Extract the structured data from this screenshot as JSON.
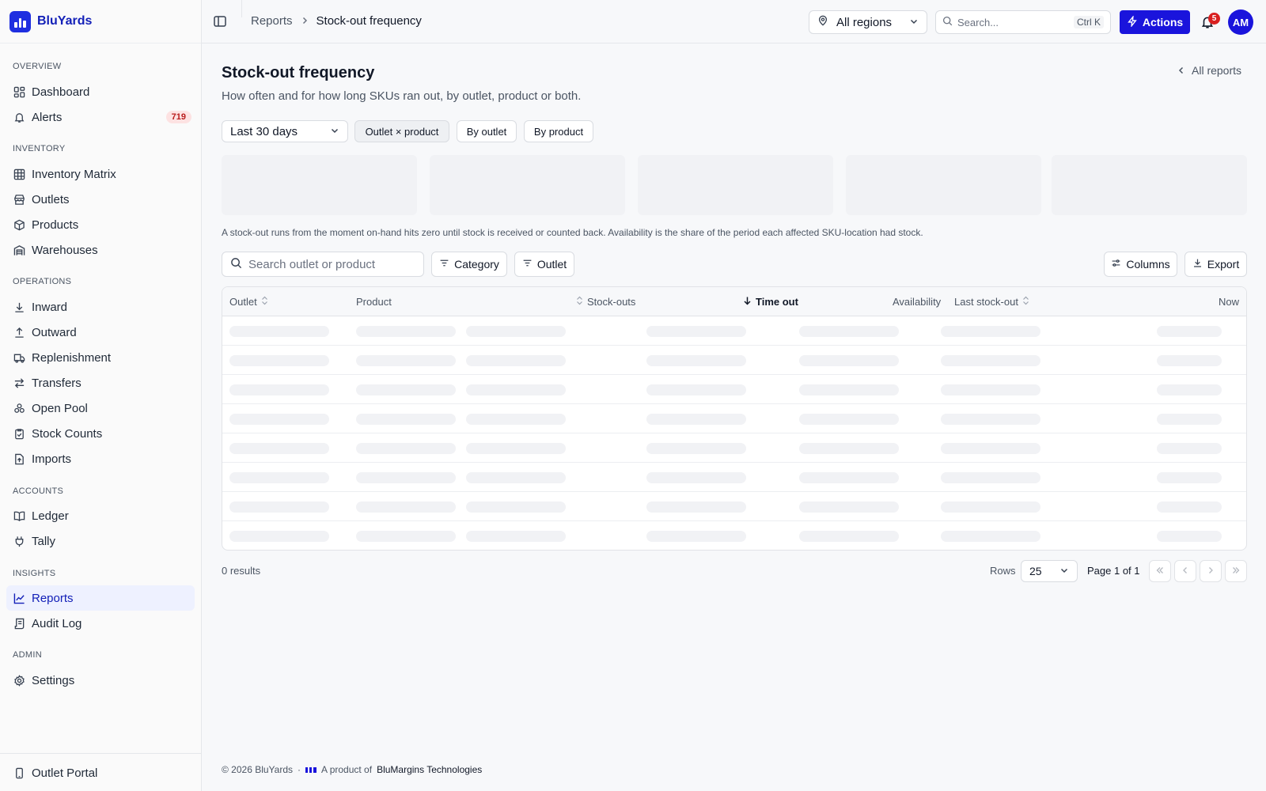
{
  "app": {
    "name": "BluYards"
  },
  "sidebar": {
    "sections": [
      {
        "label": "OVERVIEW",
        "items": [
          {
            "label": "Dashboard",
            "icon": "dashboard-icon"
          },
          {
            "label": "Alerts",
            "icon": "bell-icon",
            "badge": "719"
          }
        ]
      },
      {
        "label": "INVENTORY",
        "items": [
          {
            "label": "Inventory Matrix",
            "icon": "grid-icon"
          },
          {
            "label": "Outlets",
            "icon": "store-icon"
          },
          {
            "label": "Products",
            "icon": "box-icon"
          },
          {
            "label": "Warehouses",
            "icon": "warehouse-icon"
          }
        ]
      },
      {
        "label": "OPERATIONS",
        "items": [
          {
            "label": "Inward",
            "icon": "arrow-down-icon"
          },
          {
            "label": "Outward",
            "icon": "arrow-up-icon"
          },
          {
            "label": "Replenishment",
            "icon": "truck-icon"
          },
          {
            "label": "Transfers",
            "icon": "transfer-icon"
          },
          {
            "label": "Open Pool",
            "icon": "pool-icon"
          },
          {
            "label": "Stock Counts",
            "icon": "clipboard-icon"
          },
          {
            "label": "Imports",
            "icon": "file-import-icon"
          }
        ]
      },
      {
        "label": "ACCOUNTS",
        "items": [
          {
            "label": "Ledger",
            "icon": "book-icon"
          },
          {
            "label": "Tally",
            "icon": "plug-icon"
          }
        ]
      },
      {
        "label": "INSIGHTS",
        "items": [
          {
            "label": "Reports",
            "icon": "chart-line-icon",
            "active": true
          },
          {
            "label": "Audit Log",
            "icon": "log-icon"
          }
        ]
      },
      {
        "label": "ADMIN",
        "items": [
          {
            "label": "Settings",
            "icon": "gear-icon"
          }
        ]
      }
    ],
    "footer_item": {
      "label": "Outlet Portal",
      "icon": "phone-icon"
    }
  },
  "topbar": {
    "breadcrumb": [
      "Reports",
      "Stock-out frequency"
    ],
    "region": "All regions",
    "search_placeholder": "Search...",
    "search_shortcut": "Ctrl K",
    "actions_label": "Actions",
    "notifications_count": "5",
    "avatar_initials": "AM"
  },
  "page": {
    "title": "Stock-out frequency",
    "subtitle": "How often and for how long SKUs ran out, by outlet, product or both.",
    "back_link": "All reports",
    "range": "Last 30 days",
    "views": [
      {
        "label": "Outlet × product",
        "active": true
      },
      {
        "label": "By outlet",
        "active": false
      },
      {
        "label": "By product",
        "active": false
      }
    ],
    "note": "A stock-out runs from the moment on-hand hits zero until stock is received or counted back. Availability is the share of the period each affected SKU-location had stock."
  },
  "table": {
    "search_placeholder": "Search outlet or product",
    "filters": [
      "Category",
      "Outlet"
    ],
    "columns_label": "Columns",
    "export_label": "Export",
    "headers": [
      "Outlet",
      "Product",
      "Stock-outs",
      "Time out",
      "Availability",
      "Last stock-out",
      "Now"
    ],
    "sorted_column": "Time out",
    "loading_rows": 8
  },
  "pagination": {
    "results": "0 results",
    "rows_label": "Rows",
    "rows_value": "25",
    "page_info": "Page 1 of 1"
  },
  "footer": {
    "copyright": "© 2026 BluYards",
    "separator": "·",
    "product_of": "A product of",
    "company": "BluMargins Technologies"
  },
  "colors": {
    "brand": "#1320b8",
    "accent": "#1a14dc",
    "badge_red": "#d92020",
    "active_nav_bg": "#eef1ff"
  }
}
